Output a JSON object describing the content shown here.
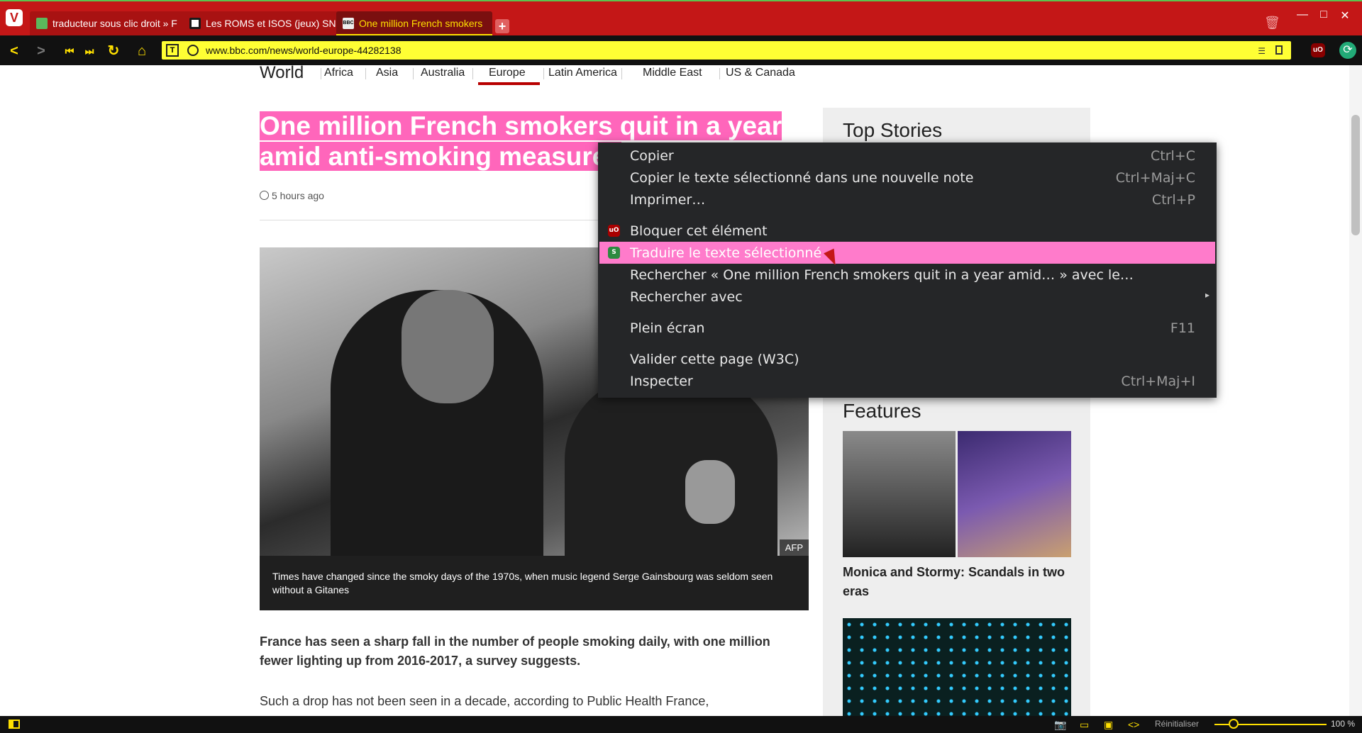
{
  "browser": {
    "tabs": [
      {
        "title": "traducteur sous clic droit » F",
        "favicon_color": "#5cb85c"
      },
      {
        "title": "Les ROMS et ISOS (jeux) SNE",
        "favicon_color": "#1a1a1a"
      },
      {
        "title": "One million French smokers",
        "favicon_color": "#eeeeee",
        "active": true
      }
    ],
    "new_tab_label": "+",
    "url": "www.bbc.com/news/world-europe-44282138",
    "accent_color": "#ffe000",
    "tabbar_color": "#c41717"
  },
  "page": {
    "nav": {
      "world": "World",
      "links": [
        "Africa",
        "Asia",
        "Australia",
        "Europe",
        "Latin America",
        "Middle East",
        "US & Canada"
      ],
      "active": "Europe"
    },
    "headline_line1": "One million French smokers quit in a year",
    "headline_line2": "amid anti-smoking measures",
    "timestamp": "5 hours ago",
    "image_credit": "AFP",
    "caption": "Times have changed since the smoky days of the 1970s, when music legend Serge Gainsbourg was seldom seen without a Gitanes",
    "lead": "France has seen a sharp fall in the number of people smoking daily, with one million fewer lighting up from 2016-2017, a survey suggests.",
    "paragraph": "Such a drop has not been seen in a decade, according to Public Health France,",
    "sidebar": {
      "top_stories": "Top Stories",
      "features": "Features",
      "feature_title": "Monica and Stormy: Scandals in two eras"
    }
  },
  "context_menu": {
    "items": [
      {
        "label": "Copier",
        "shortcut": "Ctrl+C"
      },
      {
        "label": "Copier le texte sélectionné dans une nouvelle note",
        "shortcut": "Ctrl+Maj+C"
      },
      {
        "label": "Imprimer…",
        "shortcut": "Ctrl+P"
      },
      {
        "label": "Bloquer cet élément",
        "shortcut": ""
      },
      {
        "label": "Traduire le texte sélectionné",
        "shortcut": "",
        "highlighted": true
      },
      {
        "label": "Rechercher « One million French smokers quit in a year amid… » avec le…",
        "shortcut": ""
      },
      {
        "label": "Rechercher avec",
        "shortcut": ""
      },
      {
        "label": "Plein écran",
        "shortcut": "F11"
      },
      {
        "label": "Valider cette page (W3C)",
        "shortcut": ""
      },
      {
        "label": "Inspecter",
        "shortcut": "Ctrl+Maj+I"
      }
    ],
    "highlight_color": "#ff7bcb"
  },
  "statusbar": {
    "reset_label": "Réinitialiser",
    "zoom": "100 %"
  }
}
